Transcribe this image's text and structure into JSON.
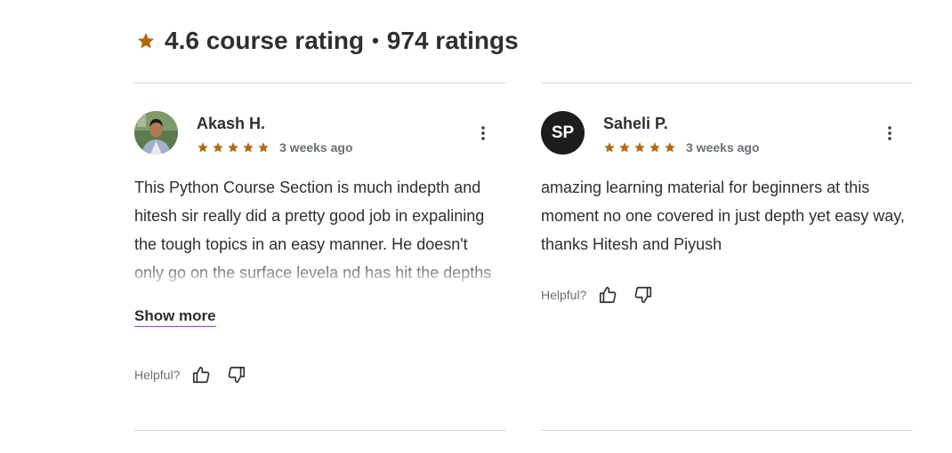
{
  "summary": {
    "rating_text": "4.6 course rating",
    "separator": "•",
    "count_text": "974 ratings",
    "star_color": "#b4690e"
  },
  "reviews": [
    {
      "name": "Akash H.",
      "avatar": "photo",
      "stars": 5,
      "time": "3 weeks ago",
      "text": "This Python Course Section is much indepth and hitesh sir really did a pretty good job in expalining the tough topics in an easy manner. He doesn't only go on the surface levela nd has hit the depths which are very rarely done",
      "show_more": "Show more",
      "helpful_label": "Helpful?"
    },
    {
      "name": "Saheli P.",
      "avatar_initials": "SP",
      "stars": 5,
      "time": "3 weeks ago",
      "text": "amazing learning material for beginners at this moment no one covered in just depth yet easy way, thanks Hitesh and Piyush",
      "helpful_label": "Helpful?"
    }
  ]
}
